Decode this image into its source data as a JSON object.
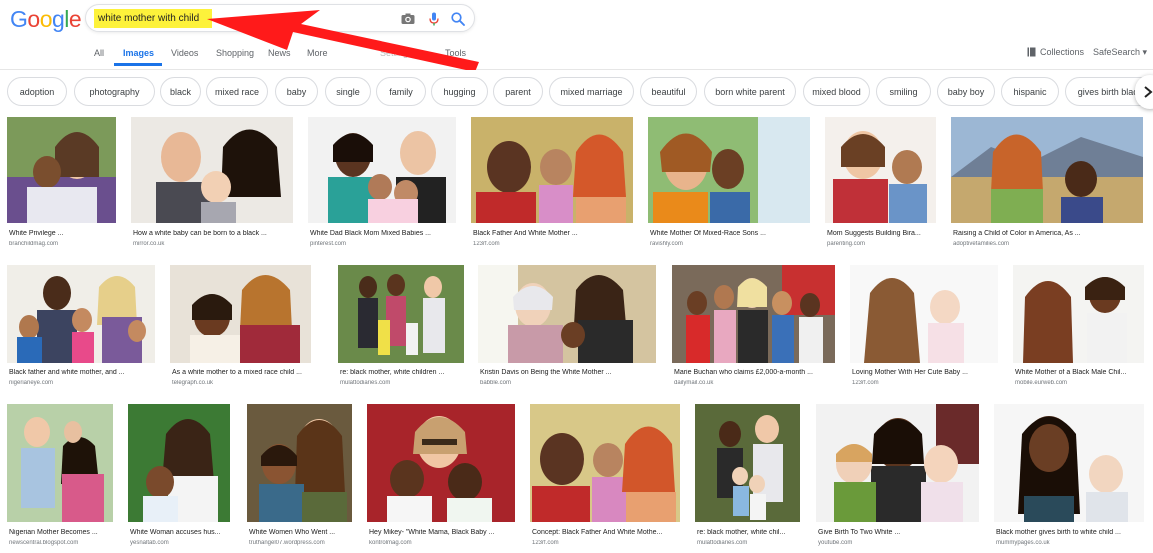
{
  "logo": {
    "letters": [
      "G",
      "o",
      "o",
      "g",
      "l",
      "e"
    ],
    "colors": [
      "#4285f4",
      "#ea4335",
      "#fbbc05",
      "#4285f4",
      "#34a853",
      "#ea4335"
    ]
  },
  "search": {
    "query": "white mother with child"
  },
  "tabs": [
    "All",
    "Images",
    "Videos",
    "Shopping",
    "News",
    "More",
    "Settings",
    "Tools"
  ],
  "active_tab": "Images",
  "toolbar": {
    "collections": "Collections",
    "safesearch": "SafeSearch ▾"
  },
  "accent_color": "#1a73e8",
  "highlight_color": "#fdf23b",
  "arrow_color": "#ff1a1a",
  "chips": [
    "adoption",
    "photography",
    "black",
    "mixed race",
    "baby",
    "single",
    "family",
    "hugging",
    "parent",
    "mixed marriage",
    "beautiful",
    "born white parent",
    "mixed blood",
    "smiling",
    "baby boy",
    "hispanic",
    "gives birth black"
  ],
  "rows": [
    [
      {
        "caption": "White Privilege ...",
        "source": "branchildmag.com"
      },
      {
        "caption": "How a white baby can be born to a black ...",
        "source": "mirror.co.uk"
      },
      {
        "caption": "White Dad Black Mom Mixed Babies ...",
        "source": "pinterest.com"
      },
      {
        "caption": "Black Father And White Mother ...",
        "source": "123rf.com"
      },
      {
        "caption": "White Mother Of Mixed-Race Sons ...",
        "source": "ravishly.com"
      },
      {
        "caption": "Mom Suggests Building Bira...",
        "source": "parenting.com"
      },
      {
        "caption": "Raising a Child of Color in America, As ...",
        "source": "adoptivefamilies.com"
      }
    ],
    [
      {
        "caption": "Black father and white mother, and ...",
        "source": "nigerianeye.com"
      },
      {
        "caption": "As a white mother to a mixed race child ...",
        "source": "telegraph.co.uk"
      },
      {
        "caption": "re: black mother, white children ...",
        "source": "mulattodiaries.com"
      },
      {
        "caption": "Kristin Davis on Being the White Mother ...",
        "source": "babble.com"
      },
      {
        "caption": "Marie Buchan who claims £2,000-a-month ...",
        "source": "dailymail.co.uk"
      },
      {
        "caption": "Loving Mother With Her Cute Baby ...",
        "source": "123rf.com"
      },
      {
        "caption": "White Mother of a Black Male Chil...",
        "source": "mobile.eurweb.com"
      }
    ],
    [
      {
        "caption": "Nigerian Mother Becomes ...",
        "source": "newscentral.blogspot.com"
      },
      {
        "caption": "White Woman accuses hus...",
        "source": "yesnaltab.com"
      },
      {
        "caption": "White Women Who Went ...",
        "source": "truthangel07.wordpress.com"
      },
      {
        "caption": "Hey Mikey- \"White Mama, Black Baby ...",
        "source": "kontrolmag.com"
      },
      {
        "caption": "Concept: Black Father And White Mothe...",
        "source": "123rf.com"
      },
      {
        "caption": "re: black mother, white chil...",
        "source": "mulattodiaries.com"
      },
      {
        "caption": "Give Birth To Two White ...",
        "source": "youtube.com"
      },
      {
        "caption": "Black mother gives birth to white child ...",
        "source": "mummypages.co.uk"
      }
    ]
  ]
}
